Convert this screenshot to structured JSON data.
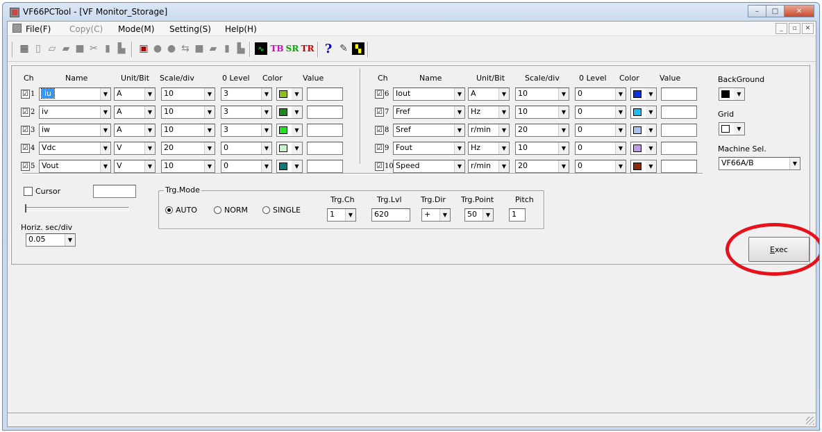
{
  "window": {
    "title": "VF66PCTool - [VF Monitor_Storage]",
    "btn_min": "–",
    "btn_max": "□",
    "btn_close": "✕"
  },
  "menu": {
    "file": "File(F)",
    "copy": "Copy(C)",
    "mode": "Mode(M)",
    "setting": "Setting(S)",
    "help": "Help(H)"
  },
  "toolbar": {
    "tb": "TB",
    "sr": "SR",
    "tr": "TR",
    "help": "?"
  },
  "headers": {
    "ch": "Ch",
    "name": "Name",
    "unit": "Unit/Bit",
    "scale": "Scale/div",
    "level": "0 Level",
    "color": "Color",
    "value": "Value"
  },
  "channels_left": [
    {
      "ch": "1",
      "name": "iu",
      "unit": "A",
      "scale": "10",
      "level": "3",
      "color": "#8fbe20",
      "checked": "☑"
    },
    {
      "ch": "2",
      "name": "iv",
      "unit": "A",
      "scale": "10",
      "level": "3",
      "color": "#1a8a1a",
      "checked": "☑"
    },
    {
      "ch": "3",
      "name": "iw",
      "unit": "A",
      "scale": "10",
      "level": "3",
      "color": "#22e022",
      "checked": "☑"
    },
    {
      "ch": "4",
      "name": "Vdc",
      "unit": "V",
      "scale": "20",
      "level": "0",
      "color": "#c8f5c8",
      "checked": "☑"
    },
    {
      "ch": "5",
      "name": "Vout",
      "unit": "V",
      "scale": "10",
      "level": "0",
      "color": "#0a7a78",
      "checked": "☑"
    }
  ],
  "channels_right": [
    {
      "ch": "6",
      "name": "Iout",
      "unit": "A",
      "scale": "10",
      "level": "0",
      "color": "#1030e0",
      "checked": "☑"
    },
    {
      "ch": "7",
      "name": "Fref",
      "unit": "Hz",
      "scale": "10",
      "level": "0",
      "color": "#22b8f0",
      "checked": "☑"
    },
    {
      "ch": "8",
      "name": "Sref",
      "unit": "r/min",
      "scale": "20",
      "level": "0",
      "color": "#a8c4ee",
      "checked": "☑"
    },
    {
      "ch": "9",
      "name": "Fout",
      "unit": "Hz",
      "scale": "10",
      "level": "0",
      "color": "#c09ae8",
      "checked": "☑"
    },
    {
      "ch": "10",
      "name": "Speed",
      "unit": "r/min",
      "scale": "20",
      "level": "0",
      "color": "#8a2a0a",
      "checked": "☑"
    }
  ],
  "side": {
    "background_label": "BackGround",
    "background_color": "#000000",
    "grid_label": "Grid",
    "grid_color": "#ffffff",
    "machine_label": "Machine Sel.",
    "machine_value": "VF66A/B"
  },
  "cursor": {
    "label": "Cursor",
    "value": ""
  },
  "horiz": {
    "label": "Horiz. sec/div",
    "value": "0.05"
  },
  "trigger": {
    "mode_label": "Trg.Mode",
    "auto": "AUTO",
    "norm": "NORM",
    "single": "SINGLE",
    "selected": "AUTO",
    "ch_label": "Trg.Ch",
    "ch_value": "1",
    "lvl_label": "Trg.Lvl",
    "lvl_value": "620",
    "dir_label": "Trg.Dir",
    "dir_value": "+",
    "point_label": "Trg.Point",
    "point_value": "50",
    "pitch_label": "Pitch",
    "pitch_value": "1"
  },
  "exec": {
    "label_pre": "",
    "label_key": "E",
    "label_post": "xec"
  }
}
